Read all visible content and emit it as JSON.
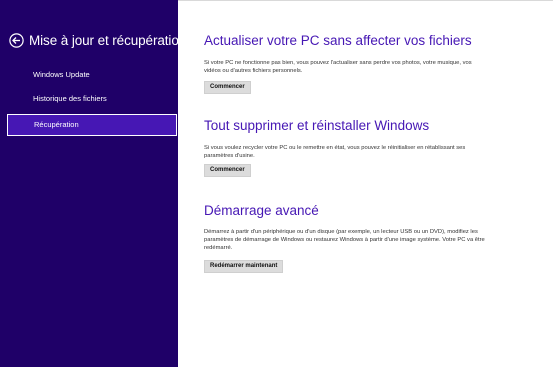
{
  "colors": {
    "sidebar_bg": "#1f0068",
    "selected_bg": "#4617b4",
    "heading": "#4617b4"
  },
  "sidebar": {
    "back_icon": "back-arrow-circle-icon",
    "title": "Mise à jour et récupération",
    "search_icon": "search-icon",
    "items": [
      {
        "label": "Windows Update",
        "selected": false
      },
      {
        "label": "Historique des fichiers",
        "selected": false
      },
      {
        "label": "Récupération",
        "selected": true
      }
    ]
  },
  "sections": [
    {
      "heading": "Actualiser votre PC sans affecter vos fichiers",
      "description": "Si votre PC ne fonctionne pas bien, vous pouvez l'actualiser sans perdre vos photos, votre musique, vos vidéos ou d'autres fichiers personnels.",
      "button": "Commencer"
    },
    {
      "heading": "Tout supprimer et réinstaller Windows",
      "description": "Si vous voulez recycler votre PC ou le remettre en état, vous pouvez le réinitialiser en rétablissant ses paramètres d'usine.",
      "button": "Commencer"
    },
    {
      "heading": "Démarrage avancé",
      "description": "Démarrez à partir d'un périphérique ou d'un disque (par exemple, un lecteur USB ou un DVD), modifiez les paramètres de démarrage de Windows ou restaurez Windows à partir d'une image système. Votre PC va être redémarré.",
      "button": "Redémarrer maintenant"
    }
  ]
}
